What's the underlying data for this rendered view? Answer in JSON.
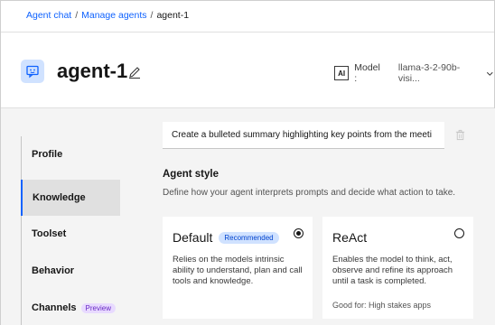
{
  "breadcrumb": {
    "items": [
      "Agent chat",
      "Manage agents"
    ],
    "separator": "/",
    "current": "agent-1"
  },
  "header": {
    "title": "agent-1",
    "avatar_icon": "chat-bot-icon",
    "edit_icon": "pencil-icon",
    "model": {
      "badge": "AI",
      "label": "Model :",
      "value": "llama-3-2-90b-visi..."
    }
  },
  "sidebar": {
    "items": [
      {
        "label": "Profile"
      },
      {
        "label": "Knowledge",
        "active": true
      },
      {
        "label": "Toolset"
      },
      {
        "label": "Behavior"
      },
      {
        "label": "Channels",
        "tag": "Preview"
      }
    ]
  },
  "main": {
    "prompt_text": "Create a bulleted summary highlighting key points from the meeti",
    "agent_style": {
      "title": "Agent style",
      "description": "Define how your agent interprets prompts and decide what action to take."
    },
    "cards": [
      {
        "title": "Default",
        "tag": "Recommended",
        "selected": true,
        "description": "Relies on the models intrinsic ability to understand, plan and call tools and knowledge."
      },
      {
        "title": "ReAct",
        "selected": false,
        "description": "Enables the model to think, act, observe and refine its approach until a task is completed.",
        "good_for": "Good for: High stakes apps"
      }
    ]
  },
  "colors": {
    "accent": "#0f62fe",
    "background": "#f4f4f4",
    "preview_tag": "#6929c4",
    "recommended_tag": "#0043ce"
  }
}
